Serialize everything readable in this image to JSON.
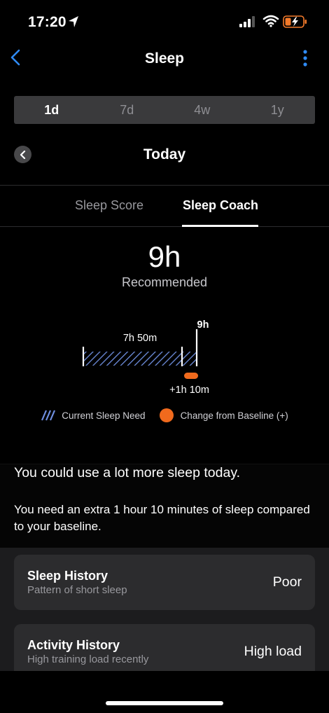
{
  "status_bar": {
    "time": "17:20"
  },
  "header": {
    "title": "Sleep"
  },
  "period_tabs": [
    {
      "label": "1d",
      "active": true
    },
    {
      "label": "7d",
      "active": false
    },
    {
      "label": "4w",
      "active": false
    },
    {
      "label": "1y",
      "active": false
    }
  ],
  "date": {
    "label": "Today"
  },
  "sub_tabs": [
    {
      "label": "Sleep Score",
      "active": false
    },
    {
      "label": "Sleep Coach",
      "active": true
    }
  ],
  "recommendation": {
    "value": "9h",
    "label": "Recommended"
  },
  "chart": {
    "current_label": "7h 50m",
    "total_label": "9h",
    "change_label": "+1h 10m",
    "current_need_minutes": 470,
    "recommended_minutes": 540,
    "change_minutes": 70
  },
  "legend": {
    "current": "Current Sleep Need",
    "change": "Change from Baseline (+)"
  },
  "message": {
    "title": "You could use a lot more sleep today.",
    "body": "You need an extra 1 hour 10 minutes of sleep compared to your baseline."
  },
  "cards": [
    {
      "title": "Sleep History",
      "subtitle": "Pattern of short sleep",
      "value": "Poor"
    },
    {
      "title": "Activity History",
      "subtitle": "High training load recently",
      "value": "High load"
    }
  ],
  "colors": {
    "accent_blue": "#2f8bf5",
    "change_orange": "#f06a1d",
    "hatch_blue": "#6f8fe0"
  }
}
